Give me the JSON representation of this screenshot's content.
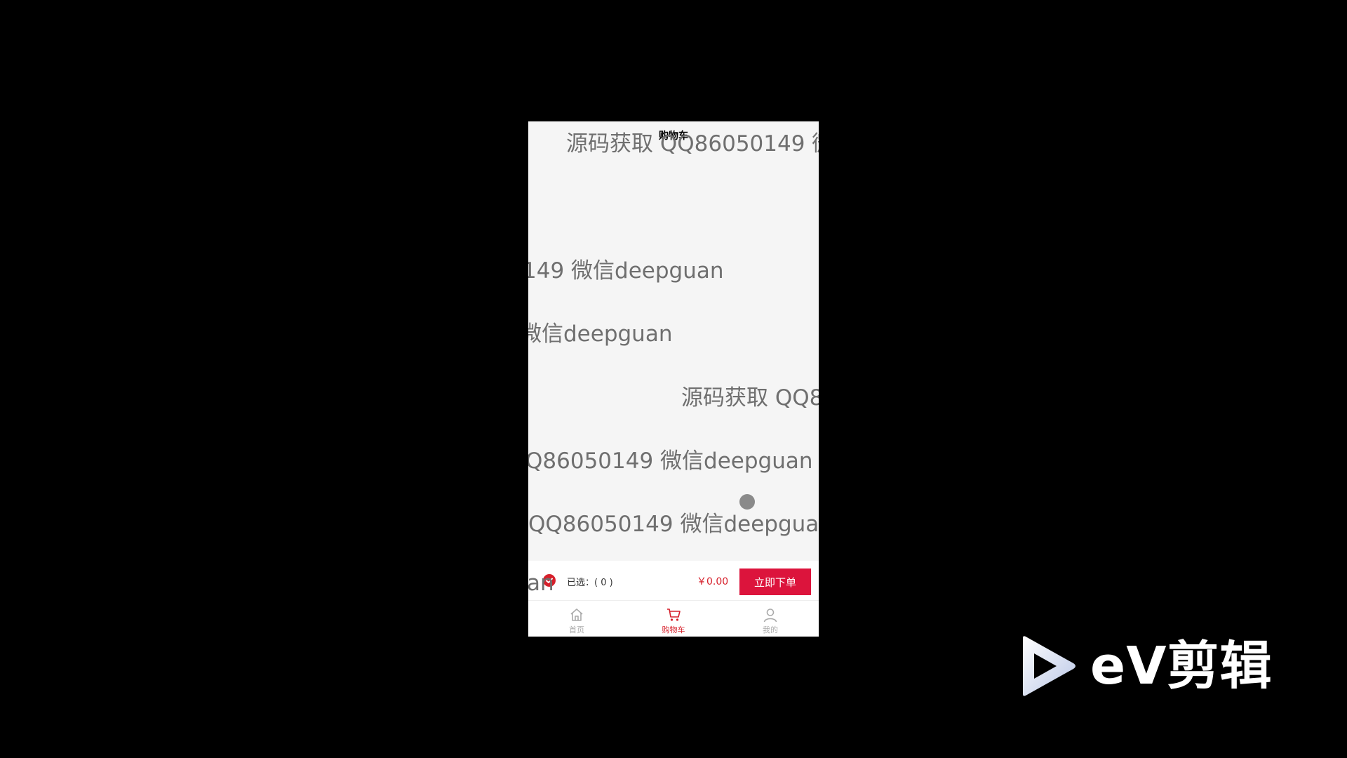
{
  "header": {
    "title": "购物车"
  },
  "watermarks": [
    "源码获取 QQ86050149 微",
    "149 微信deepguan",
    "微信deepguan",
    "源码获取 QQ8",
    "Q86050149 微信deepguan",
    "QQ86050149 微信deepguan",
    "an"
  ],
  "checkout_bar": {
    "selected_label": "已选：( 0 )",
    "price": "￥0.00",
    "order_button": "立即下单"
  },
  "tabbar": {
    "items": [
      {
        "label": "首页",
        "icon": "home-icon",
        "active": false
      },
      {
        "label": "购物车",
        "icon": "cart-icon",
        "active": true
      },
      {
        "label": "我的",
        "icon": "user-icon",
        "active": false
      }
    ]
  },
  "branding": {
    "logo_text": "eV剪辑"
  },
  "colors": {
    "accent": "#dc143c",
    "page_bg": "#f5f5f5",
    "frame_bg": "#000000"
  }
}
